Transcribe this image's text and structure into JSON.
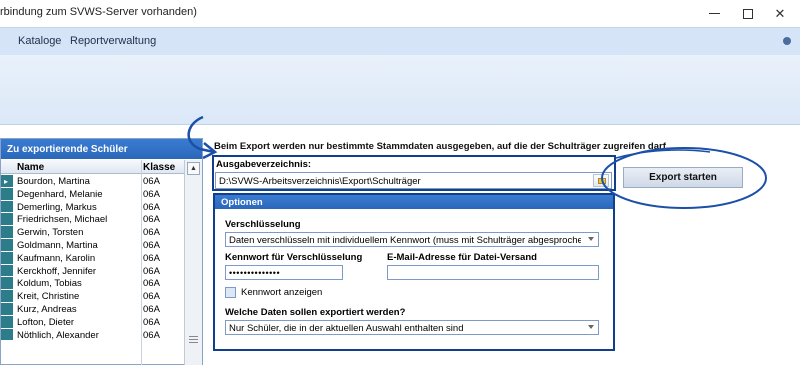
{
  "window": {
    "title": "rbindung zum SVWS-Server vorhanden)"
  },
  "menu": {
    "items": [
      {
        "label": "Kataloge"
      },
      {
        "label": "Reportverwaltung"
      }
    ]
  },
  "student_panel": {
    "title": "Zu exportierende Schüler",
    "columns": {
      "name": "Name",
      "klasse": "Klasse"
    },
    "rows": [
      {
        "name": "Bourdon, Martina",
        "klasse": "06A",
        "selected": true
      },
      {
        "name": "Degenhard, Melanie",
        "klasse": "06A"
      },
      {
        "name": "Demerling, Markus",
        "klasse": "06A"
      },
      {
        "name": "Friedrichsen, Michael",
        "klasse": "06A"
      },
      {
        "name": "Gerwin, Torsten",
        "klasse": "06A"
      },
      {
        "name": "Goldmann, Martina",
        "klasse": "06A"
      },
      {
        "name": "Kaufmann, Karolin",
        "klasse": "06A"
      },
      {
        "name": "Kerckhoff, Jennifer",
        "klasse": "06A"
      },
      {
        "name": "Koldum, Tobias",
        "klasse": "06A"
      },
      {
        "name": "Kreit, Christine",
        "klasse": "06A"
      },
      {
        "name": "Kurz, Andreas",
        "klasse": "06A"
      },
      {
        "name": "Lofton, Dieter",
        "klasse": "06A"
      },
      {
        "name": "Nöthlich, Alexander",
        "klasse": "06A"
      }
    ]
  },
  "export": {
    "info_text": "Beim Export werden nur bestimmte Stammdaten ausgegeben, auf die der Schulträger zugreifen darf.",
    "output_label": "Ausgabeverzeichnis:",
    "output_path": "D:\\SVWS-Arbeitsverzeichnis\\Export\\Schulträger",
    "start_button": "Export starten"
  },
  "options": {
    "title": "Optionen",
    "encryption_label": "Verschlüsselung",
    "encryption_value": "Daten verschlüsseln mit individuellem Kennwort (muss mit Schulträger abgesprochen w",
    "password_label": "Kennwort für Verschlüsselung",
    "password_value": "••••••••••••••",
    "email_label": "E-Mail-Adresse für Datei-Versand",
    "email_value": "",
    "show_password_label": "Kennwort anzeigen",
    "which_data_label": "Welche Daten sollen exportiert werden?",
    "which_data_value": "Nur Schüler, die in der aktuellen Auswahl enthalten sind"
  },
  "colors": {
    "annotation": "#1b4fa8",
    "panel_header": "#2f6fc4",
    "row_indicator": "#2c7c8a"
  }
}
